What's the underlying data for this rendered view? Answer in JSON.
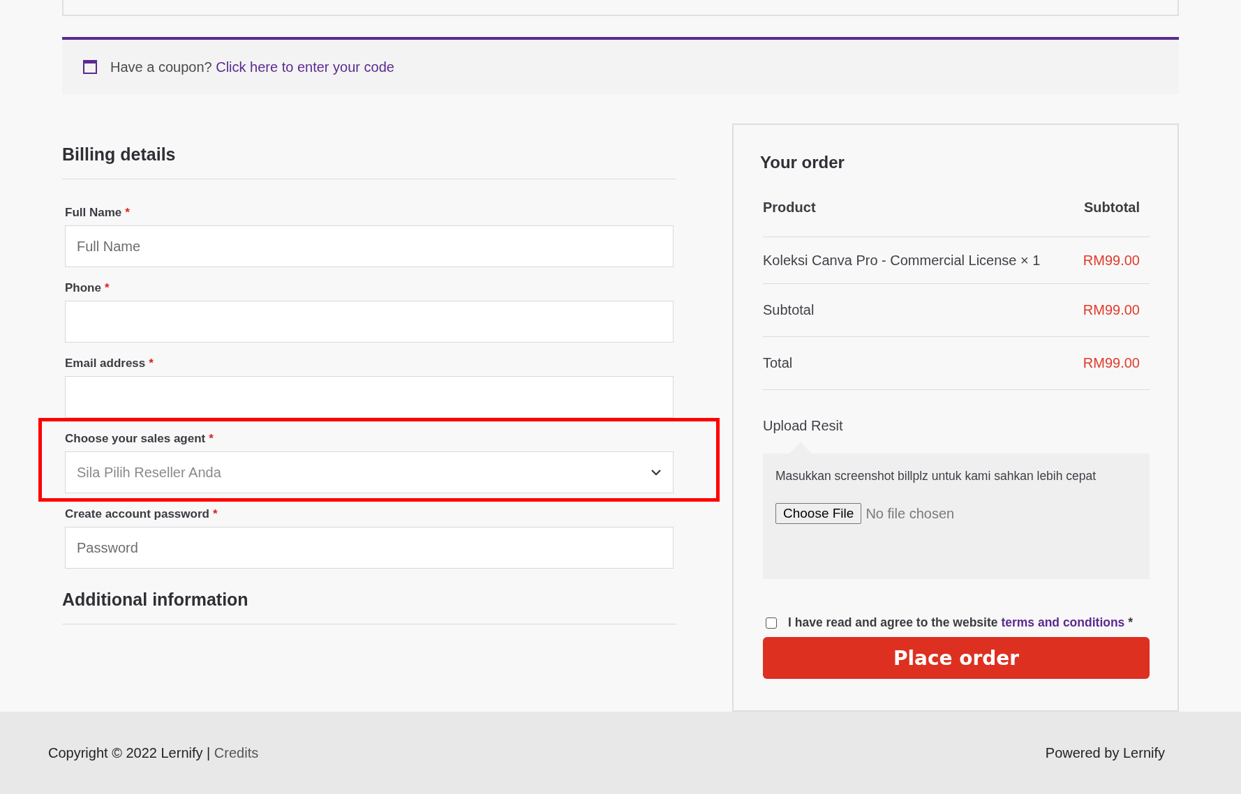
{
  "coupon": {
    "text": "Have a coupon?",
    "link": "Click here to enter your code"
  },
  "billing": {
    "title": "Billing details",
    "fields": [
      {
        "kind": "input",
        "label": "Full Name",
        "required_mark": "*",
        "placeholder": "Full Name",
        "highlighted": false
      },
      {
        "kind": "input",
        "label": "Phone",
        "required_mark": "*",
        "highlighted": false
      },
      {
        "kind": "input",
        "label": "Email address",
        "required_mark": "*",
        "highlighted": false
      },
      {
        "kind": "select",
        "label": "Choose your sales agent",
        "required_mark": "*",
        "placeholder": "Sila Pilih Reseller Anda",
        "highlighted": true
      },
      {
        "kind": "input",
        "label": "Create account password",
        "required_mark": "*",
        "placeholder": "Password",
        "highlighted": false
      }
    ]
  },
  "additional": {
    "title": "Additional information"
  },
  "order": {
    "title": "Your order",
    "columns": [
      "Product",
      "Subtotal"
    ],
    "rows": [
      {
        "kind": "item",
        "label": "Koleksi Canva Pro - Commercial License × 1",
        "amount": "RM99.00"
      },
      {
        "kind": "total",
        "label": "Subtotal",
        "amount": "RM99.00"
      },
      {
        "kind": "total",
        "label": "Total",
        "amount": "RM99.00"
      }
    ],
    "upload": {
      "label": "Upload Resit",
      "hint": "Masukkan screenshot billplz untuk kami sahkan lebih cepat",
      "button": "Choose File",
      "status": "No file chosen"
    },
    "terms": {
      "checked": false,
      "text": "I have read and agree to the website",
      "link": "terms and conditions",
      "required_mark": "*"
    },
    "button": "Place order"
  },
  "footer": {
    "copyright": "Copyright © 2022 Lernify |",
    "credits": "Credits",
    "powered": "Powered by Lernify"
  }
}
